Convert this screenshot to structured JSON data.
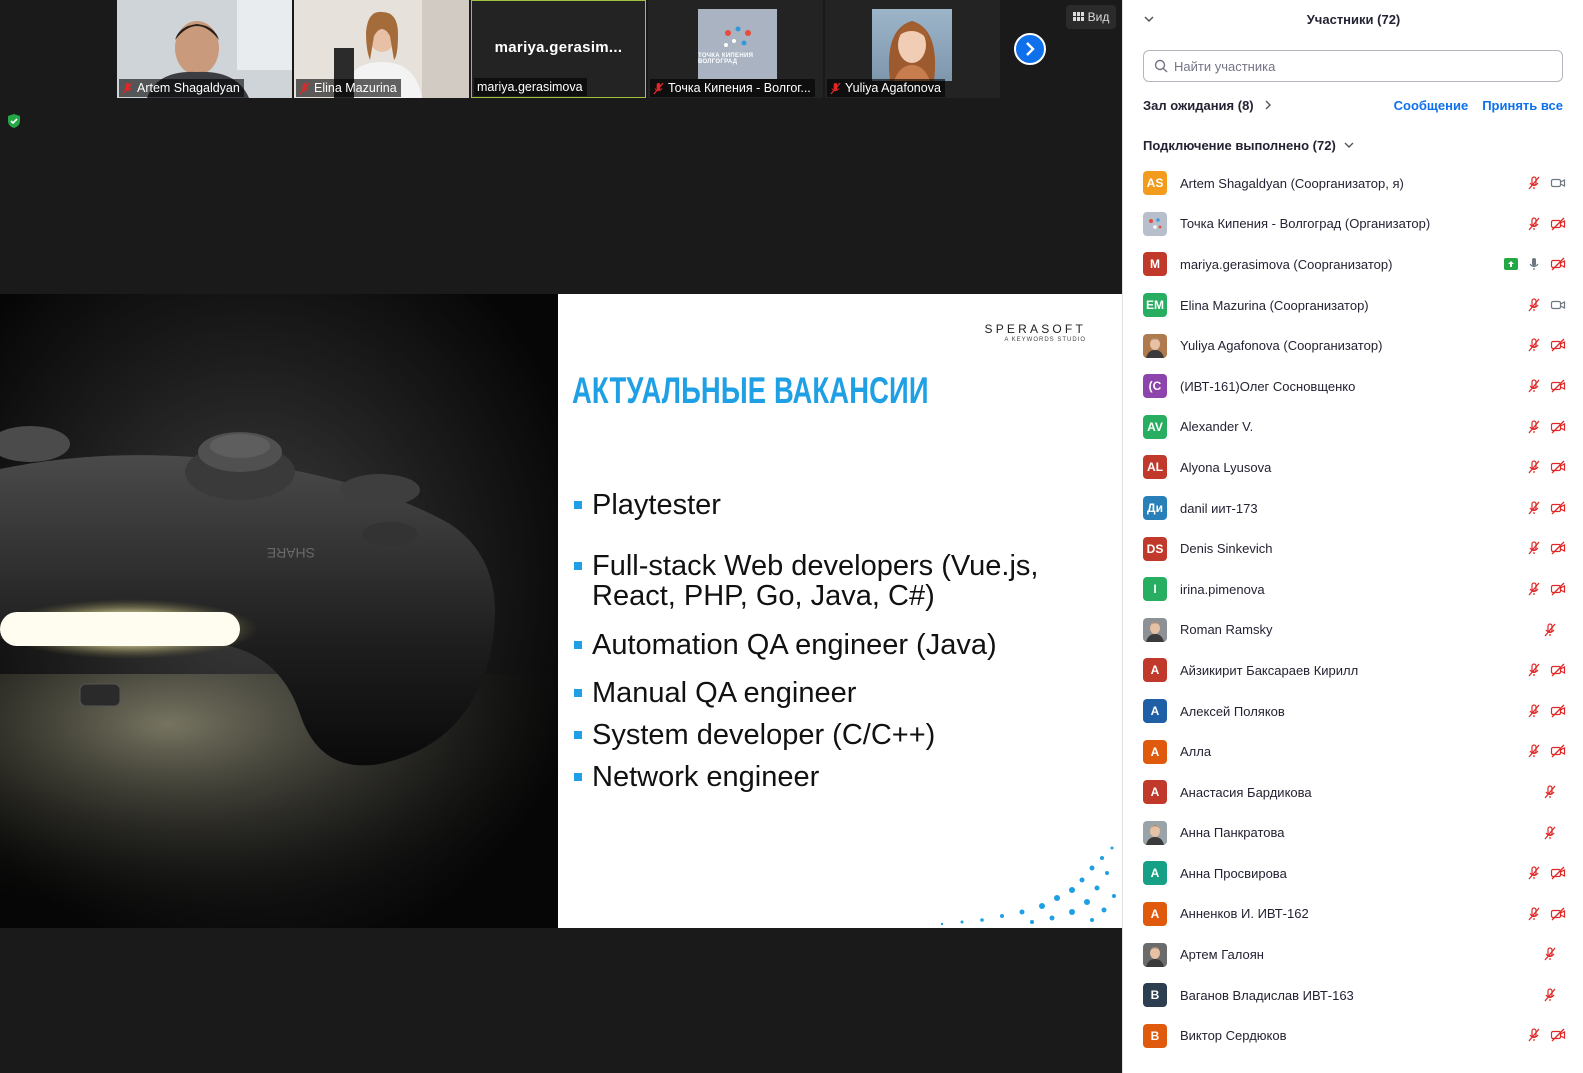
{
  "thumbnails": [
    {
      "name": "Artem Shagaldyan",
      "muted": true,
      "kind": "video"
    },
    {
      "name": "Elina Mazurina",
      "muted": true,
      "kind": "video"
    },
    {
      "name": "mariya.gerasimova",
      "big_name": "mariya.gerasim...",
      "muted": false,
      "kind": "name",
      "active": true
    },
    {
      "name": "Точка Кипения - Волгог...",
      "logo_text": "ТОЧКА КИПЕНИЯ ВОЛГОГРАД",
      "muted": true,
      "kind": "logo"
    },
    {
      "name": "Yuliya Agafonova",
      "muted": true,
      "kind": "portrait"
    }
  ],
  "view_button": "Вид",
  "slide": {
    "logo_main": "SPERASOFT",
    "logo_sub": "A KEYWORDS STUDIO",
    "title": "АКТУАЛЬНЫЕ ВАКАНСИИ",
    "bullets": [
      "Playtester",
      "Full-stack Web developers (Vue.js, React, PHP, Go, Java, C#)",
      "Automation QA engineer (Java)",
      "Manual QA engineer",
      "System developer (C/C++)",
      "Network engineer"
    ]
  },
  "panel": {
    "title": "Участники (72)",
    "search_placeholder": "Найти участника",
    "waiting_room": "Зал ожидания (8)",
    "message_button": "Сообщение",
    "admit_all_button": "Принять все",
    "connected": "Подключение выполнено (72)"
  },
  "participants": [
    {
      "name": "Artem Shagaldyan (Соорганизатор, я)",
      "initials": "AS",
      "color": "#f29b1d",
      "mic": "muted",
      "video": "on"
    },
    {
      "name": "Точка Кипения - Волгоград (Организатор)",
      "initials": "",
      "color": "#b7bfcc",
      "mic": "muted",
      "video": "off",
      "avatar_type": "logo"
    },
    {
      "name": "mariya.gerasimova (Соорганизатор)",
      "initials": "M",
      "color": "#c0392b",
      "mic": "on",
      "video": "off",
      "sharing": true
    },
    {
      "name": "Elina Mazurina (Соорганизатор)",
      "initials": "EM",
      "color": "#27ae60",
      "mic": "muted",
      "video": "on"
    },
    {
      "name": "Yuliya Agafonova (Соорганизатор)",
      "initials": "",
      "color": "#b07a4f",
      "mic": "muted",
      "video": "off",
      "avatar_type": "photo"
    },
    {
      "name": "(ИВТ-161)Олег Сосновщенко",
      "initials": "(С",
      "color": "#8e44ad",
      "mic": "muted",
      "video": "off"
    },
    {
      "name": "Alexander V.",
      "initials": "AV",
      "color": "#27ae60",
      "mic": "muted",
      "video": "off"
    },
    {
      "name": "Alyona Lyusova",
      "initials": "AL",
      "color": "#c0392b",
      "mic": "muted",
      "video": "off"
    },
    {
      "name": "danil иит-173",
      "initials": "Ди",
      "color": "#2980b9",
      "mic": "muted",
      "video": "off"
    },
    {
      "name": "Denis Sinkevich",
      "initials": "DS",
      "color": "#c0392b",
      "mic": "muted",
      "video": "off"
    },
    {
      "name": "irina.pimenova",
      "initials": "I",
      "color": "#27ae60",
      "mic": "muted",
      "video": "off"
    },
    {
      "name": "Roman Ramsky",
      "initials": "",
      "color": "#8d9095",
      "mic": "muted",
      "video": "none",
      "avatar_type": "photo"
    },
    {
      "name": "Айзикирит Баксараев Кирилл",
      "initials": "А",
      "color": "#c0392b",
      "mic": "muted",
      "video": "off"
    },
    {
      "name": "Алексей Поляков",
      "initials": "А",
      "color": "#1f5fa6",
      "mic": "muted",
      "video": "off"
    },
    {
      "name": "Алла",
      "initials": "А",
      "color": "#e05a0e",
      "mic": "muted",
      "video": "off"
    },
    {
      "name": "Анастасия Бардикова",
      "initials": "А",
      "color": "#c0392b",
      "mic": "muted",
      "video": "none"
    },
    {
      "name": "Анна Панкратова",
      "initials": "",
      "color": "#9aa3a8",
      "mic": "muted",
      "video": "none",
      "avatar_type": "photo"
    },
    {
      "name": "Анна Просвирова",
      "initials": "А",
      "color": "#16a085",
      "mic": "muted",
      "video": "off"
    },
    {
      "name": "Анненков И. ИВТ-162",
      "initials": "А",
      "color": "#e05a0e",
      "mic": "muted",
      "video": "off"
    },
    {
      "name": "Артем Галоян",
      "initials": "",
      "color": "#6b6b6b",
      "mic": "muted",
      "video": "none",
      "avatar_type": "photo"
    },
    {
      "name": "Ваганов Владислав ИВТ-163",
      "initials": "В",
      "color": "#2c3e50",
      "mic": "muted",
      "video": "none"
    },
    {
      "name": "Виктор Сердюков",
      "initials": "В",
      "color": "#e05a0e",
      "mic": "muted",
      "video": "off"
    }
  ]
}
